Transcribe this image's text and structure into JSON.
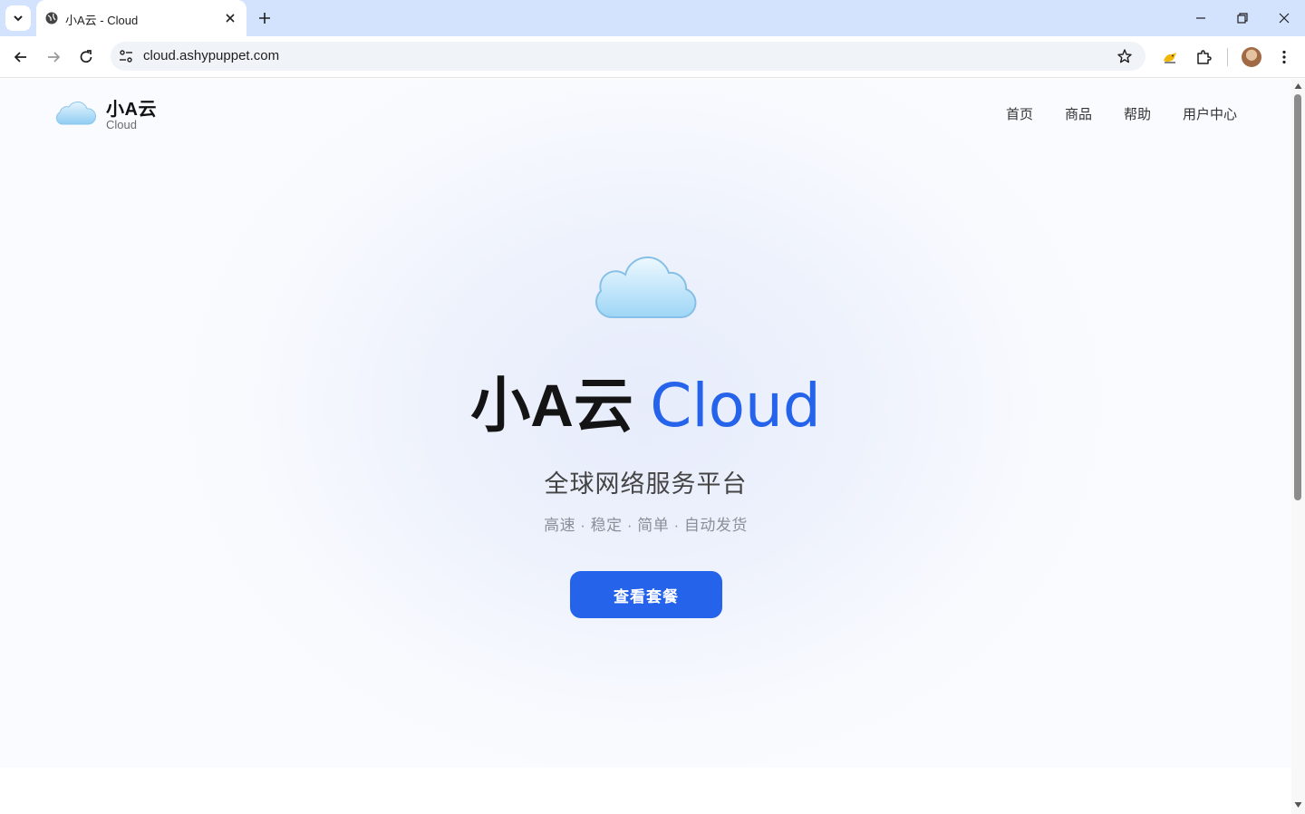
{
  "browser": {
    "tab": {
      "title": "小A云 - Cloud"
    },
    "address_bar": {
      "url": "cloud.ashypuppet.com"
    },
    "icons": [
      "tab-search-icon",
      "globe-icon",
      "close-icon",
      "plus-icon",
      "minimize-icon",
      "restore-icon",
      "window-close-icon",
      "back-icon",
      "forward-icon",
      "reload-icon",
      "site-info-icon",
      "star-icon",
      "extension-icon",
      "puzzle-icon",
      "avatar",
      "more-icon"
    ]
  },
  "site": {
    "brand": {
      "name": "小A云",
      "subtitle": "Cloud"
    },
    "nav": [
      {
        "label": "首页"
      },
      {
        "label": "商品"
      },
      {
        "label": "帮助"
      },
      {
        "label": "用户中心"
      }
    ],
    "hero": {
      "title_cn": "小A云",
      "title_en": "Cloud",
      "subtitle": "全球网络服务平台",
      "tagline": "高速 · 稳定 · 简单 · 自动发货",
      "cta_label": "查看套餐"
    },
    "colors": {
      "accent": "#2563eb",
      "tabstrip": "#d3e3fd"
    }
  }
}
